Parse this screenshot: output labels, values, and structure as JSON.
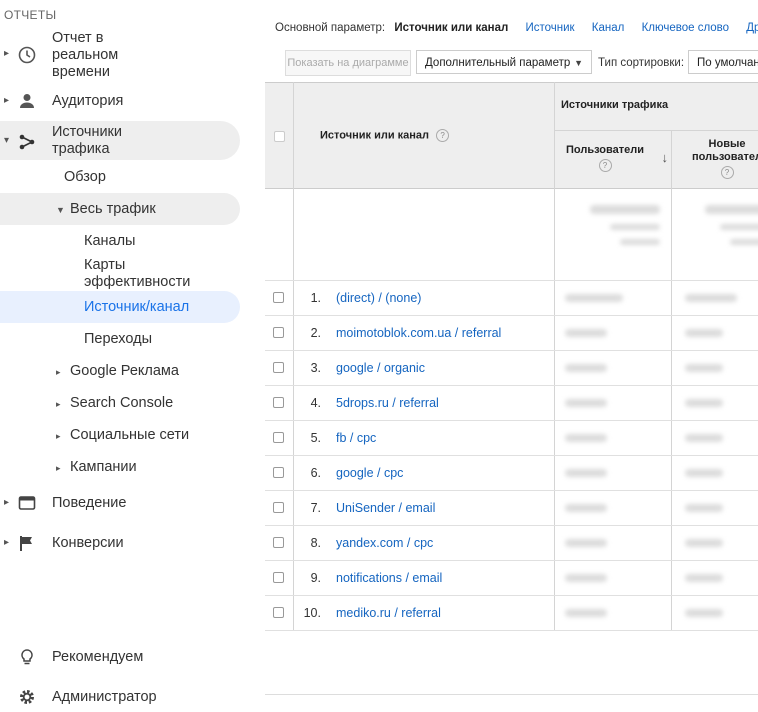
{
  "sidebar": {
    "section_title": "ОТЧЕТЫ",
    "realtime": "Отчет в\nреальном\nвремени",
    "audience": "Аудитория",
    "acquisition": "Источники\nтрафика",
    "overview": "Обзор",
    "all_traffic": "Весь трафик",
    "channels": "Каналы",
    "treemaps": "Карты\nэффективности",
    "source_medium": "Источник/канал",
    "referrals": "Переходы",
    "google_ads": "Google Реклама",
    "search_console": "Search Console",
    "social": "Социальные сети",
    "campaigns": "Кампании",
    "behavior": "Поведение",
    "conversions": "Конверсии",
    "discover": "Рекомендуем",
    "admin": "Администратор"
  },
  "dimension_bar": {
    "label": "Основной параметр:",
    "current": "Источник или канал",
    "links": [
      "Источник",
      "Канал",
      "Ключевое слово",
      "Другое"
    ]
  },
  "toolbar": {
    "plot_rows": "Показать на диаграмме",
    "secondary_dimension": "Дополнительный параметр",
    "sort_type_label": "Тип сортировки:",
    "sort_type_value": "По умолчан"
  },
  "table": {
    "dim_header": "Источник или канал",
    "group_header": "Источники трафика",
    "col_users": "Пользователи",
    "col_new_users_1": "Новые",
    "col_new_users_2": "пользовател",
    "rows": [
      {
        "n": "1.",
        "source": "(direct) / (none)"
      },
      {
        "n": "2.",
        "source": "moimotoblok.com.ua / referral"
      },
      {
        "n": "3.",
        "source": "google / organic"
      },
      {
        "n": "4.",
        "source": "5drops.ru / referral"
      },
      {
        "n": "5.",
        "source": "fb / cpc"
      },
      {
        "n": "6.",
        "source": "google / cpc"
      },
      {
        "n": "7.",
        "source": "UniSender / email"
      },
      {
        "n": "8.",
        "source": "yandex.com / cpc"
      },
      {
        "n": "9.",
        "source": "notifications / email"
      },
      {
        "n": "10.",
        "source": "mediko.ru / referral"
      }
    ]
  },
  "colors": {
    "link": "#1565c0",
    "active": "#1a73e8",
    "active_bg": "#e8f0fe"
  }
}
